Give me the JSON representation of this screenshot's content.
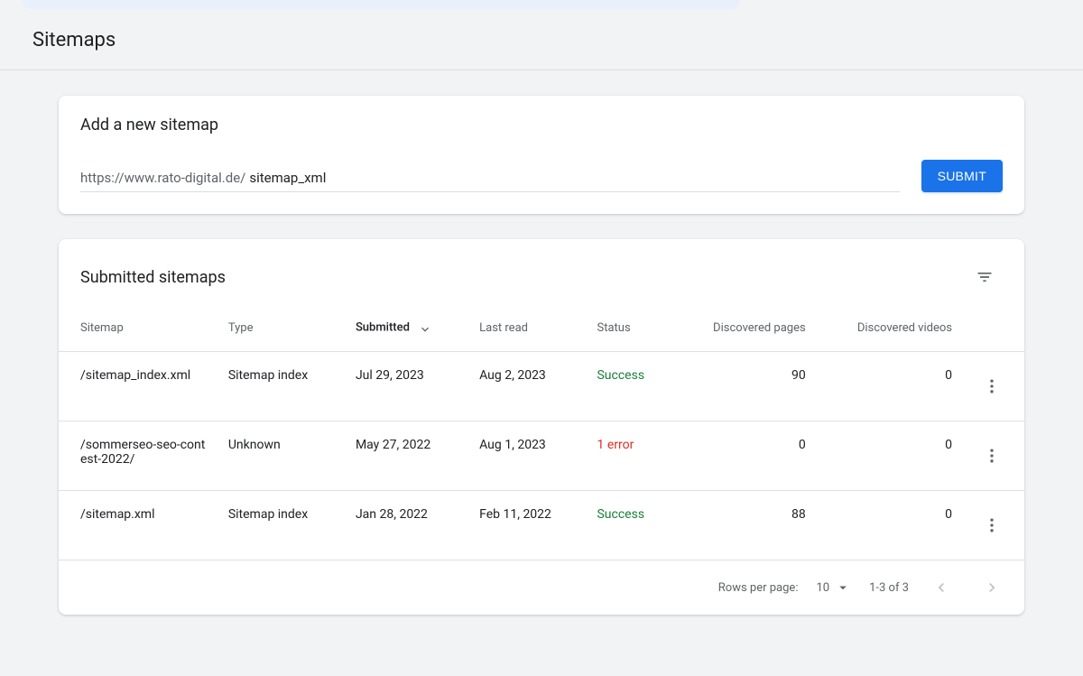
{
  "page": {
    "title": "Sitemaps"
  },
  "addCard": {
    "title": "Add a new sitemap",
    "prefix": "https://www.rato-digital.de/",
    "value": "sitemap_xml",
    "submit": "SUBMIT"
  },
  "listCard": {
    "title": "Submitted sitemaps",
    "columns": {
      "sitemap": "Sitemap",
      "type": "Type",
      "submitted": "Submitted",
      "lastRead": "Last read",
      "status": "Status",
      "discoveredPages": "Discovered pages",
      "discoveredVideos": "Discovered videos"
    },
    "rows": [
      {
        "path": "/sitemap_index.xml",
        "type": "Sitemap index",
        "submitted": "Jul 29, 2023",
        "lastRead": "Aug 2, 2023",
        "status": "Success",
        "statusClass": "success",
        "pages": "90",
        "videos": "0"
      },
      {
        "path": "/sommerseo-seo-contest-2022/",
        "type": "Unknown",
        "submitted": "May 27, 2022",
        "lastRead": "Aug 1, 2023",
        "status": "1 error",
        "statusClass": "error",
        "pages": "0",
        "videos": "0"
      },
      {
        "path": "/sitemap.xml",
        "type": "Sitemap index",
        "submitted": "Jan 28, 2022",
        "lastRead": "Feb 11, 2022",
        "status": "Success",
        "statusClass": "success",
        "pages": "88",
        "videos": "0"
      }
    ],
    "footer": {
      "rowsPerPageLabel": "Rows per page:",
      "rowsPerPage": "10",
      "range": "1-3 of 3"
    }
  }
}
